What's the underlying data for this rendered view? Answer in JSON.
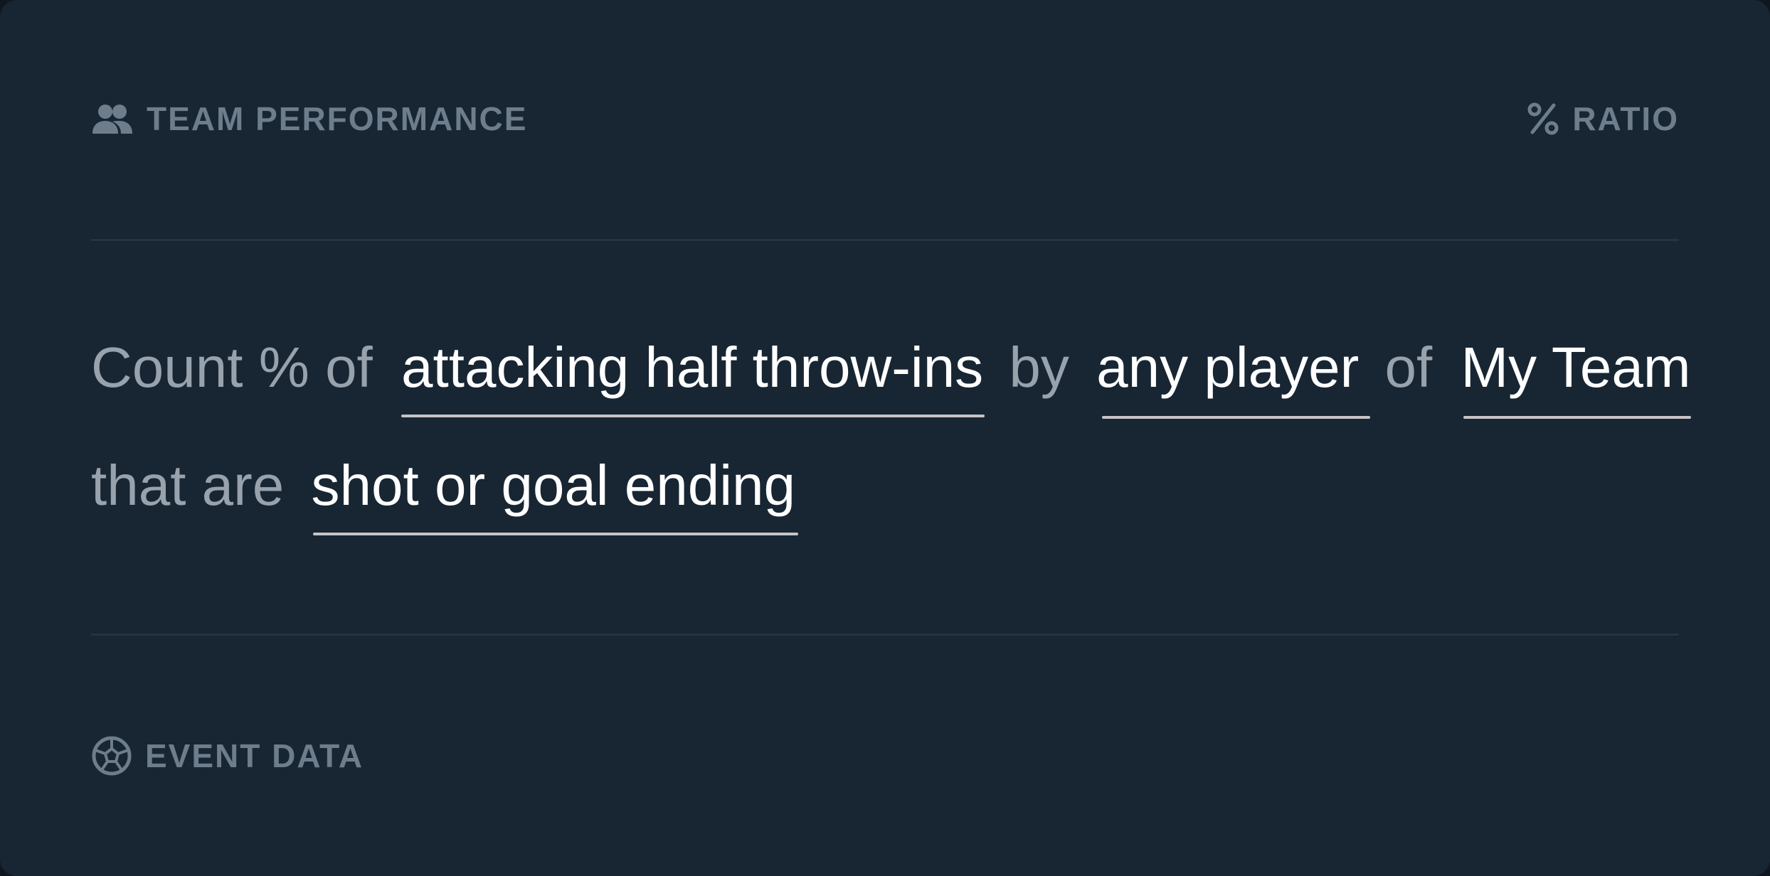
{
  "header": {
    "left_label": "TEAM PERFORMANCE",
    "left_icon": "people-icon",
    "right_label": "RATIO",
    "right_icon": "percent-icon"
  },
  "sentence": {
    "line1": {
      "t1": "Count % of",
      "v1": "attacking half throw-ins",
      "t2": "by",
      "v2": "any player",
      "t3": "of",
      "v3": "My Team"
    },
    "line2": {
      "t1": "that are",
      "v1": "shot or goal ending"
    }
  },
  "footer": {
    "label": "EVENT DATA",
    "icon": "soccer-ball-icon"
  },
  "colors": {
    "background": "#182633",
    "muted_label": "#6d7d8b",
    "static_text": "#97a2ad",
    "token_text": "#ffffff",
    "underline": "#c7c3c6",
    "divider": "#243442"
  }
}
